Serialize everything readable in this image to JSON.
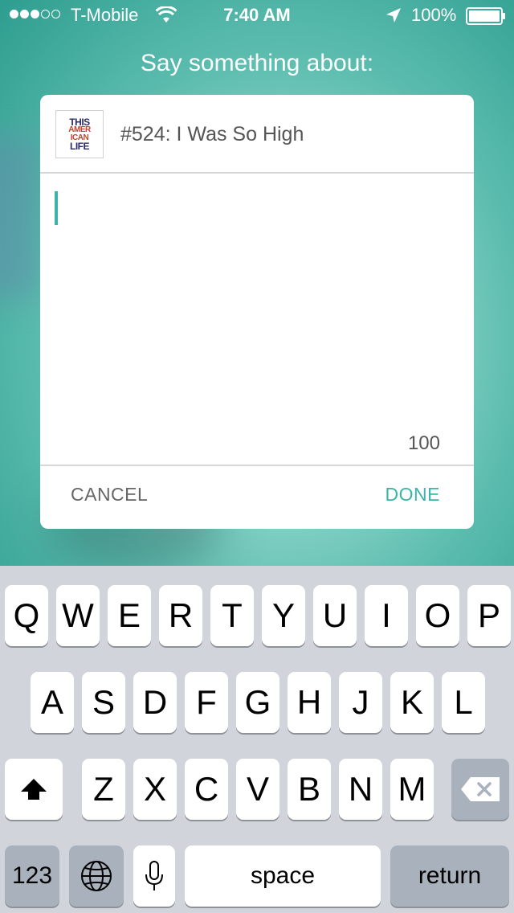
{
  "status_bar": {
    "carrier": "T-Mobile",
    "time": "7:40 AM",
    "battery": "100%",
    "signal_dots": [
      true,
      true,
      true,
      false,
      false
    ]
  },
  "prompt": {
    "title": "Say something about:"
  },
  "card": {
    "thumbnail_lines": [
      "THIS",
      "AMER",
      "ICAN",
      "LIFE"
    ],
    "episode_title": "#524: I Was So High",
    "comment_value": "",
    "char_count": "100",
    "cancel_label": "CANCEL",
    "done_label": "DONE"
  },
  "keyboard": {
    "row1": [
      "Q",
      "W",
      "E",
      "R",
      "T",
      "Y",
      "U",
      "I",
      "O",
      "P"
    ],
    "row2": [
      "A",
      "S",
      "D",
      "F",
      "G",
      "H",
      "J",
      "K",
      "L"
    ],
    "row3": [
      "Z",
      "X",
      "C",
      "V",
      "B",
      "N",
      "M"
    ],
    "numbers_label": "123",
    "space_label": "space",
    "return_label": "return"
  },
  "colors": {
    "accent": "#3bb5a7",
    "keyboard_bg": "#d1d5db",
    "dark_key": "#a9b2bc"
  },
  "icons": {
    "wifi": "wifi-icon",
    "location": "location-arrow-icon",
    "battery": "battery-icon",
    "shift": "shift-icon",
    "delete": "backspace-icon",
    "globe": "globe-icon",
    "mic": "microphone-icon"
  }
}
